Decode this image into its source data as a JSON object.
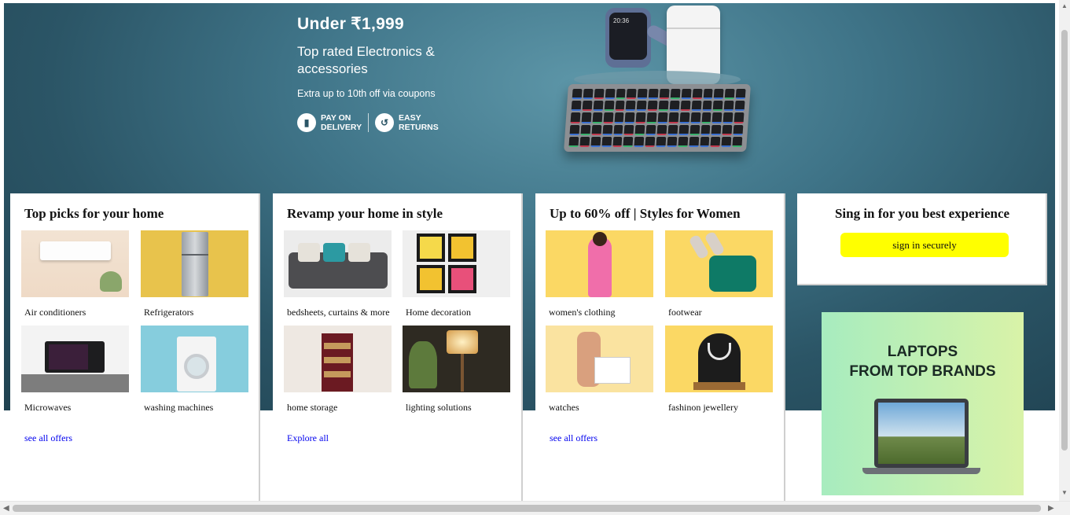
{
  "hero": {
    "title": "Under ₹1,999",
    "subtitle": "Top rated Electronics & accessories",
    "note": "Extra up to 10th off via coupons",
    "badges": [
      {
        "icon": "cash-on-delivery-icon",
        "label": "PAY ON DELIVERY"
      },
      {
        "icon": "box-return-icon",
        "label": "EASY RETURNS"
      }
    ],
    "watch_time": "20:36"
  },
  "cards": [
    {
      "title": "Top picks for your home",
      "tiles": [
        {
          "caption": "Air conditioners",
          "image": "air-conditioner-image"
        },
        {
          "caption": "Refrigerators",
          "image": "refrigerator-image"
        },
        {
          "caption": "Microwaves",
          "image": "microwave-image"
        },
        {
          "caption": "washing machines",
          "image": "washing-machine-image"
        }
      ],
      "link": "see all offers"
    },
    {
      "title": "Revamp your home in style",
      "tiles": [
        {
          "caption": "bedsheets, curtains & more",
          "image": "sofa-cushions-image"
        },
        {
          "caption": "Home decoration",
          "image": "wall-frames-image"
        },
        {
          "caption": "home storage",
          "image": "shoe-rack-image"
        },
        {
          "caption": "lighting solutions",
          "image": "floor-lamp-image"
        }
      ],
      "link": "Explore all"
    },
    {
      "title": "Up to 60% off | Styles for Women",
      "tiles": [
        {
          "caption": "women's clothing",
          "image": "womens-clothing-image"
        },
        {
          "caption": "footwear",
          "image": "footwear-image"
        },
        {
          "caption": "watches",
          "image": "watches-image"
        },
        {
          "caption": "fashinon jewellery",
          "image": "jewellery-image"
        }
      ],
      "link": "see all offers"
    }
  ],
  "signin": {
    "title": "Sing in for you best experience",
    "button": "sign in securely"
  },
  "laptop_ad": {
    "line1": "LAPTOPS",
    "line2": "FROM TOP BRANDS"
  },
  "colors": {
    "hero_bg": "#3f7488",
    "signin_button": "#ffff00",
    "link": "#0000ee",
    "laptop_ad_bg": "#c2efb4"
  }
}
